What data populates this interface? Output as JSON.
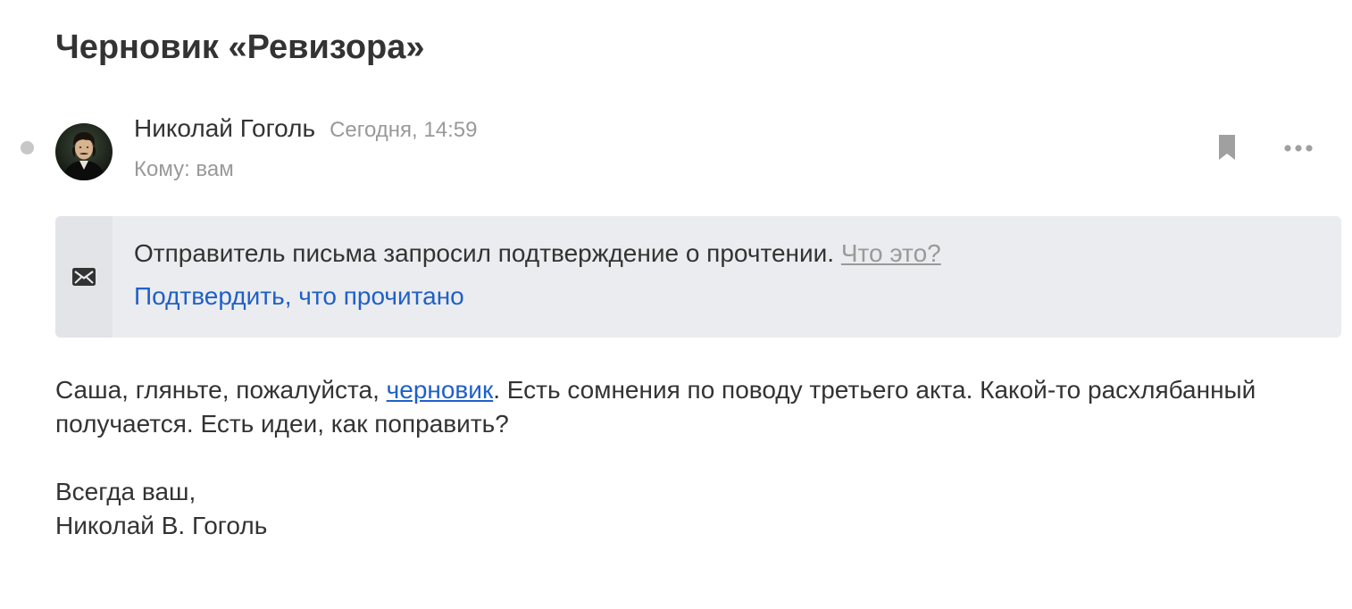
{
  "email": {
    "subject": "Черновик «Ревизора»",
    "sender_name": "Николай Гоголь",
    "sent_time": "Сегодня, 14:59",
    "recipient_label": "Кому: вам"
  },
  "toolbar": {
    "bookmark_icon": "bookmark-icon",
    "more_icon": "more-horizontal-icon"
  },
  "read_receipt": {
    "icon": "envelope-icon",
    "message": "Отправитель письма запросил подтверждение о прочтении. ",
    "help_link": "Что это?",
    "confirm_link": "Подтвердить, что прочитано"
  },
  "body": {
    "text_before_link": "Саша, гляньте, пожалуйста, ",
    "link_text": "черновик",
    "text_after_link": ". Есть сомнения по поводу третьего акта. Какой-то расхлябанный получается. Есть идеи, как поправить?",
    "signature_line1": "Всегда ваш,",
    "signature_line2": "Николай В. Гоголь"
  },
  "colors": {
    "text": "#333333",
    "muted": "#999999",
    "link": "#1f60c9",
    "receipt_background": "#ebecef",
    "unread_dot": "#c7c7c7"
  }
}
